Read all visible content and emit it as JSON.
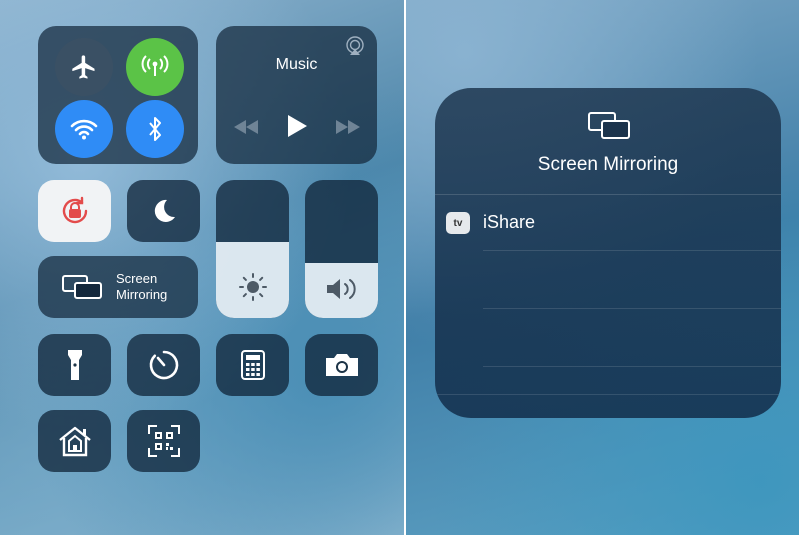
{
  "left": {
    "music": {
      "title": "Music"
    },
    "screen_mirroring_tile": {
      "line1": "Screen",
      "line2": "Mirroring"
    },
    "brightness": {
      "level": 0.55
    },
    "volume": {
      "level": 0.4
    },
    "icons": {
      "airplane": "airplane-icon",
      "cellular": "cellular-icon",
      "wifi": "wifi-icon",
      "bluetooth": "bluetooth-icon",
      "airplay": "airplay-icon",
      "rewind": "rewind-icon",
      "play": "play-icon",
      "forward": "fast-forward-icon",
      "rotation_lock": "rotation-lock-icon",
      "do_not_disturb": "moon-icon",
      "flashlight": "flashlight-icon",
      "timer": "timer-icon",
      "calculator": "calculator-icon",
      "camera": "camera-icon",
      "home": "home-icon",
      "qr": "qr-scanner-icon"
    }
  },
  "right": {
    "title": "Screen Mirroring",
    "devices": [
      {
        "badge": "tv",
        "name": "iShare"
      }
    ]
  }
}
